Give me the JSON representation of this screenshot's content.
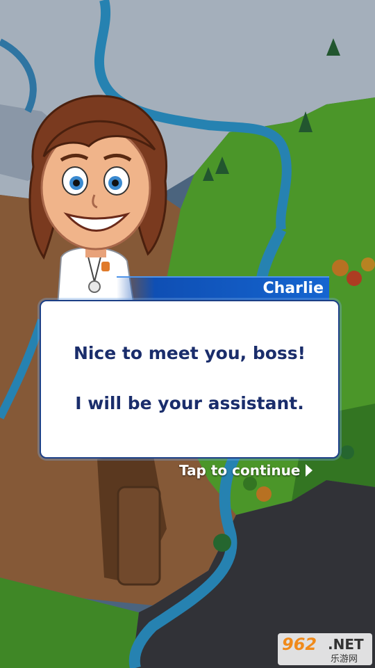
{
  "dialog": {
    "speaker": "Charlie",
    "line1": "Nice to meet you, boss!",
    "line2": "I will be your assistant.",
    "continue_label": "Tap to continue"
  },
  "watermark": {
    "number": "962",
    "net": ".NET",
    "subtitle": "乐游网"
  },
  "colors": {
    "banner": "#1565d0",
    "dialog_text": "#1a2d6b",
    "dialog_border": "#1c3f86",
    "snow": "#d9e3ee",
    "grass": "#4fb02e",
    "river": "#2a9fd6",
    "desert": "#8a5a36",
    "rock": "#3a3a40"
  },
  "icons": [
    "continue-arrow-icon"
  ]
}
